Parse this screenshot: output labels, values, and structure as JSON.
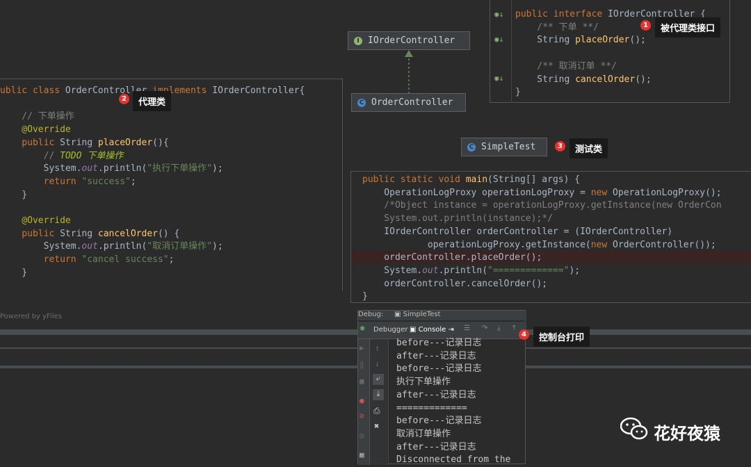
{
  "proxy_class": {
    "lines": [
      {
        "parts": [
          [
            "kw",
            "ublic class "
          ],
          [
            "ty",
            "OrderController "
          ],
          [
            "kw",
            "implements "
          ],
          [
            "ty",
            "IOrderController{"
          ]
        ]
      },
      {
        "parts": []
      },
      {
        "parts": [
          [
            "cm",
            "    // 下单操作"
          ]
        ]
      },
      {
        "parts": [
          [
            "ann",
            "    @Override"
          ]
        ]
      },
      {
        "parts": [
          [
            "kw",
            "    public "
          ],
          [
            "ty",
            "String "
          ],
          [
            "fn",
            "placeOrder"
          ],
          [
            "ty",
            "(){"
          ]
        ]
      },
      {
        "parts": [
          [
            "cm",
            "        // "
          ],
          [
            "todo",
            "TODO 下单操作"
          ]
        ]
      },
      {
        "parts": [
          [
            "ty",
            "        System."
          ],
          [
            "it",
            "out"
          ],
          [
            "ty",
            ".println("
          ],
          [
            "str",
            "\"执行下单操作\""
          ],
          [
            "ty",
            ");"
          ]
        ]
      },
      {
        "parts": [
          [
            "kw",
            "        return "
          ],
          [
            "str",
            "\"success\""
          ],
          [
            "ty",
            ";"
          ]
        ]
      },
      {
        "parts": [
          [
            "ty",
            "    }"
          ]
        ]
      },
      {
        "parts": []
      },
      {
        "parts": [
          [
            "ann",
            "    @Override"
          ]
        ]
      },
      {
        "parts": [
          [
            "kw",
            "    public "
          ],
          [
            "ty",
            "String "
          ],
          [
            "fn",
            "cancelOrder"
          ],
          [
            "ty",
            "() {"
          ]
        ]
      },
      {
        "parts": [
          [
            "ty",
            "        System."
          ],
          [
            "it",
            "out"
          ],
          [
            "ty",
            ".println("
          ],
          [
            "str",
            "\"取消订单操作\""
          ],
          [
            "ty",
            ");"
          ]
        ]
      },
      {
        "parts": [
          [
            "kw",
            "        return "
          ],
          [
            "str",
            "\"cancel success\""
          ],
          [
            "ty",
            ";"
          ]
        ]
      },
      {
        "parts": [
          [
            "ty",
            "    }"
          ]
        ]
      }
    ]
  },
  "interface_code": {
    "lines": [
      {
        "parts": [
          [
            "kw",
            "public interface "
          ],
          [
            "ty",
            "IOrderController {"
          ]
        ]
      },
      {
        "parts": [
          [
            "cm",
            "    /** 下单 **/"
          ]
        ]
      },
      {
        "parts": [
          [
            "ty",
            "    String "
          ],
          [
            "fn",
            "placeOrder"
          ],
          [
            "ty",
            "();"
          ]
        ]
      },
      {
        "parts": []
      },
      {
        "parts": [
          [
            "cm",
            "    /** 取消订单 **/"
          ]
        ]
      },
      {
        "parts": [
          [
            "ty",
            "    String "
          ],
          [
            "fn",
            "cancelOrder"
          ],
          [
            "ty",
            "();"
          ]
        ]
      },
      {
        "parts": [
          [
            "ty",
            "}"
          ]
        ]
      }
    ]
  },
  "test_code": {
    "lines": [
      {
        "parts": [
          [
            "kw",
            "public static void "
          ],
          [
            "fn",
            "main"
          ],
          [
            "ty",
            "(String[] args) {"
          ]
        ]
      },
      {
        "parts": [
          [
            "ty",
            "    OperationLogProxy operationLogProxy = "
          ],
          [
            "kw",
            "new "
          ],
          [
            "ty",
            "OperationLogProxy();"
          ]
        ]
      },
      {
        "parts": [
          [
            "cm",
            "    /*Object instance = operationLogProxy.getInstance(new OrderCon"
          ]
        ]
      },
      {
        "parts": [
          [
            "cm",
            "    System.out.println(instance);*/"
          ]
        ]
      },
      {
        "parts": [
          [
            "ty",
            "    IOrderController orderController = (IOrderController)"
          ]
        ]
      },
      {
        "parts": [
          [
            "ty",
            "            operationLogProxy.getInstance("
          ],
          [
            "kw",
            "new "
          ],
          [
            "ty",
            "OrderController());"
          ]
        ]
      },
      {
        "parts": [
          [
            "ty",
            "    orderController.placeOrder();"
          ]
        ]
      },
      {
        "parts": [
          [
            "ty",
            "    System."
          ],
          [
            "it",
            "out"
          ],
          [
            "ty",
            ".println("
          ],
          [
            "str",
            "\"=============\""
          ],
          [
            "ty",
            ");"
          ]
        ]
      },
      {
        "parts": [
          [
            "ty",
            "    orderController.cancelOrder();"
          ]
        ]
      },
      {
        "parts": [
          [
            "ty",
            "}"
          ]
        ]
      }
    ]
  },
  "diagram": {
    "interface_node": "IOrderController",
    "class_node": "OrderController",
    "test_node": "SimpleTest",
    "powered_by": "Powered by yFiles"
  },
  "callouts": [
    {
      "num": "1",
      "label": "被代理类接口"
    },
    {
      "num": "2",
      "label": "代理类"
    },
    {
      "num": "3",
      "label": "测试类"
    },
    {
      "num": "4",
      "label": "控制台打印"
    }
  ],
  "debug": {
    "tab_debug": "Debug:",
    "tab_file": "SimpleTest",
    "sub_debugger": "Debugger",
    "sub_console": "Console",
    "console_lines": [
      "before---记录日志",
      "after---记录日志",
      "before---记录日志",
      "执行下单操作",
      "after---记录日志",
      "=============",
      "before---记录日志",
      "取消订单操作",
      "after---记录日志",
      "Disconnected from the"
    ]
  },
  "watermark": "花好夜猿"
}
